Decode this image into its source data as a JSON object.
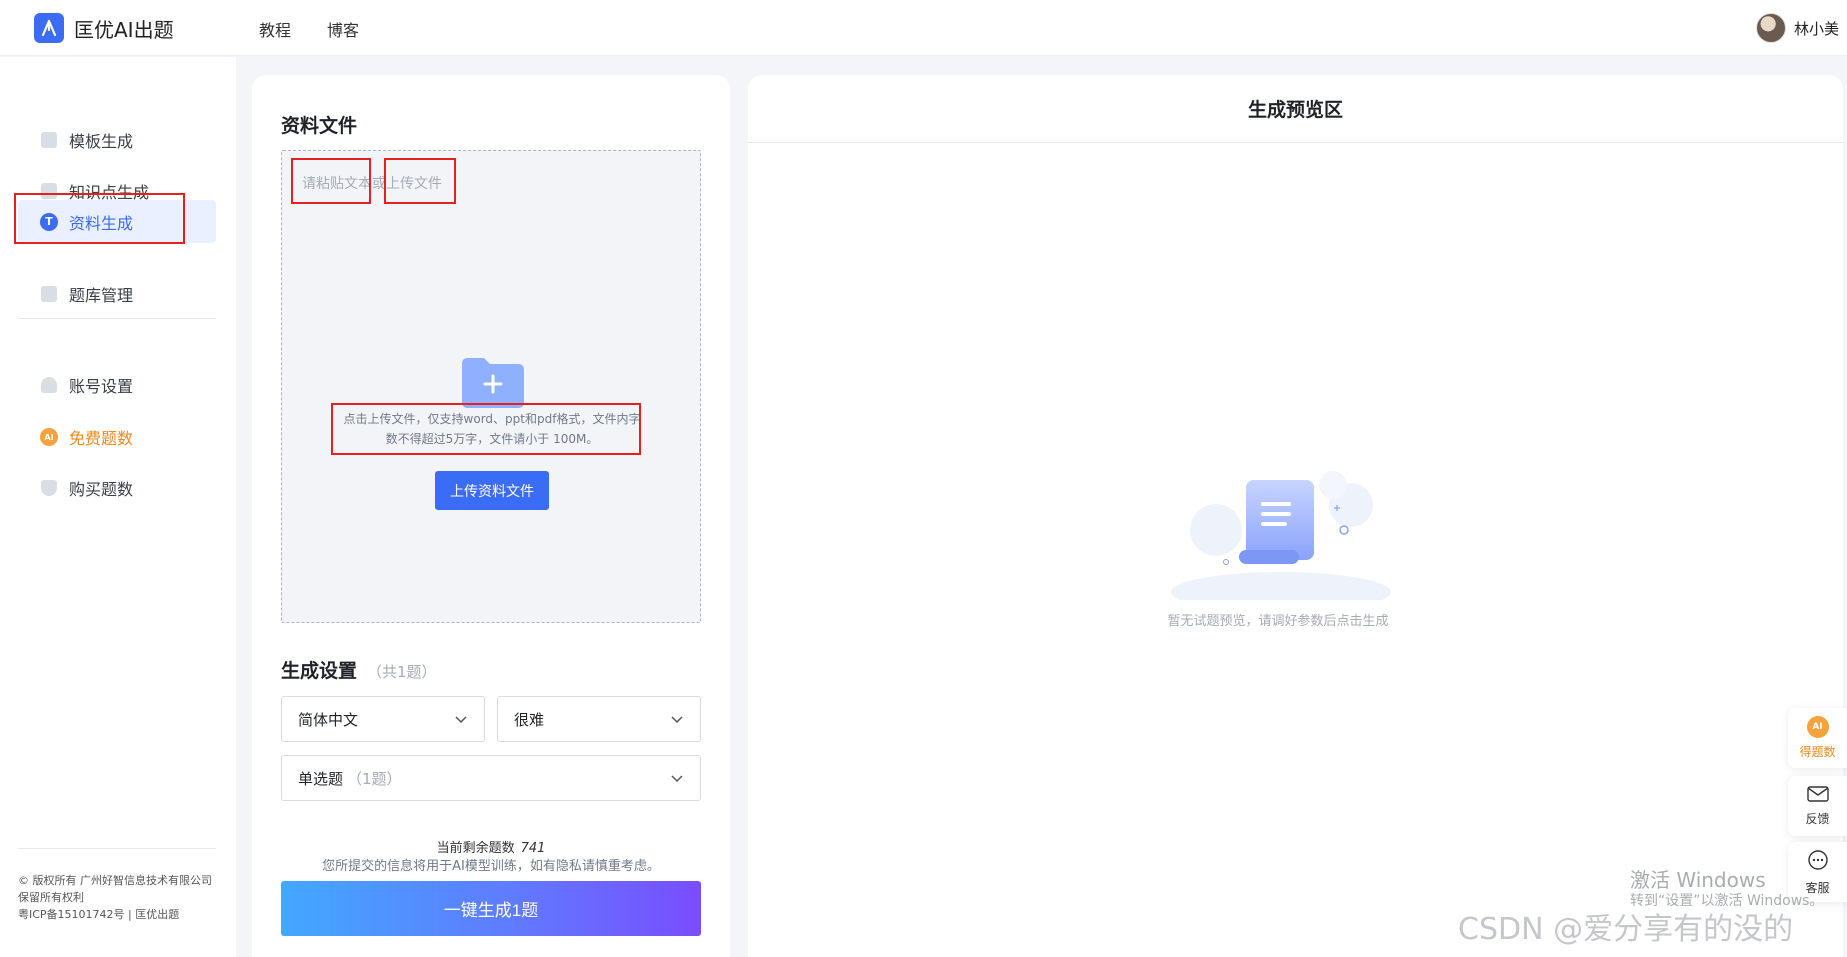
{
  "header": {
    "app_name": "匡优AI出题",
    "nav": [
      "教程",
      "博客"
    ],
    "user_name": "林小美"
  },
  "sidebar": {
    "items": [
      {
        "label": "模板生成"
      },
      {
        "label": "知识点生成"
      },
      {
        "label": "资料生成",
        "active": true
      },
      {
        "label": "题库管理"
      }
    ],
    "account_items": [
      {
        "label": "账号设置"
      },
      {
        "label": "免费题数",
        "highlight": "#f18a1b"
      },
      {
        "label": "购买题数"
      }
    ],
    "footer": {
      "copyright": "© 版权所有 广州好智信息技术有限公司",
      "rights": "保留所有权利",
      "icp": "粤ICP备15101742号 | 匡优出题"
    }
  },
  "material": {
    "title": "资料文件",
    "placeholder": "请粘贴文本或上传文件",
    "tip_line1": "点击上传文件，仅支持word、ppt和pdf格式，文件内字",
    "tip_line2": "数不得超过5万字，文件请小于 100M。",
    "upload_button": "上传资料文件"
  },
  "settings": {
    "title": "生成设置",
    "count_note": "（共1题）",
    "language": "简体中文",
    "difficulty": "很难",
    "question_type": "单选题",
    "question_type_count": "（1题）",
    "remaining_label": "当前剩余题数",
    "remaining_value": "741",
    "privacy_note": "您所提交的信息将用于AI模型训练，如有隐私请慎重考虑。",
    "generate_button": "一键生成1题"
  },
  "preview": {
    "title": "生成预览区",
    "empty_text": "暂无试题预览，请调好参数后点击生成"
  },
  "float_tools": [
    {
      "label": "得题数",
      "icon": "ai-badge-icon"
    },
    {
      "label": "反馈",
      "icon": "mail-icon"
    },
    {
      "label": "客服",
      "icon": "chat-icon"
    }
  ],
  "watermarks": {
    "activate_title": "激活 Windows",
    "activate_sub": "转到“设置”以激活 Windows。",
    "csdn": "CSDN @爱分享有的没的"
  },
  "colors": {
    "primary": "#3b6cf6",
    "orange": "#f18a1b",
    "annotation_red": "#e5211f"
  }
}
